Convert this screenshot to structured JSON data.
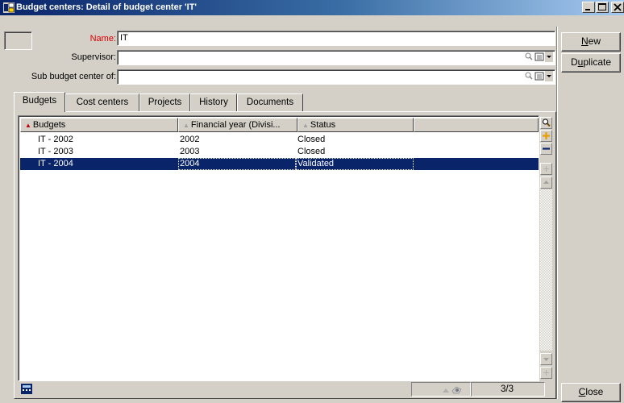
{
  "window": {
    "title": "Budget centers: Detail of budget center 'IT'",
    "controls": [
      "minimize-icon",
      "maximize-icon",
      "close-icon"
    ]
  },
  "form": {
    "name_label": "Name:",
    "name_value": "IT",
    "supervisor_label": "Supervisor:",
    "supervisor_value": "",
    "sub_budget_label": "Sub budget center of:",
    "sub_budget_value": ""
  },
  "buttons": {
    "new_u": "N",
    "new_rest": "ew",
    "dup_pre": "D",
    "dup_u": "u",
    "dup_rest": "plicate",
    "close_u": "C",
    "close_rest": "lose"
  },
  "tabs": [
    "Budgets",
    "Cost centers",
    "Projects",
    "History",
    "Documents"
  ],
  "active_tab": "Budgets",
  "list": {
    "columns": [
      "Budgets",
      "Financial year (Divisi...",
      "Status",
      ""
    ],
    "rows": [
      {
        "budget": "IT - 2002",
        "year": "2002",
        "status": "Closed",
        "selected": false
      },
      {
        "budget": "IT - 2003",
        "year": "2003",
        "status": "Closed",
        "selected": false
      },
      {
        "budget": "IT - 2004",
        "year": "2004",
        "status": "Validated",
        "selected": true
      }
    ]
  },
  "toolbar_icons": [
    "zoom-icon",
    "add-icon",
    "remove-icon",
    "expand-icon",
    "scroll-up-icon",
    "scroll-down-icon",
    "expand-bottom-icon"
  ],
  "status": {
    "counter": "3/3"
  },
  "colors": {
    "title_start": "#0a246a",
    "title_end": "#a6caf0",
    "selection": "#0a246a",
    "mandatory_label": "#e00000",
    "face": "#d4d0c8"
  }
}
